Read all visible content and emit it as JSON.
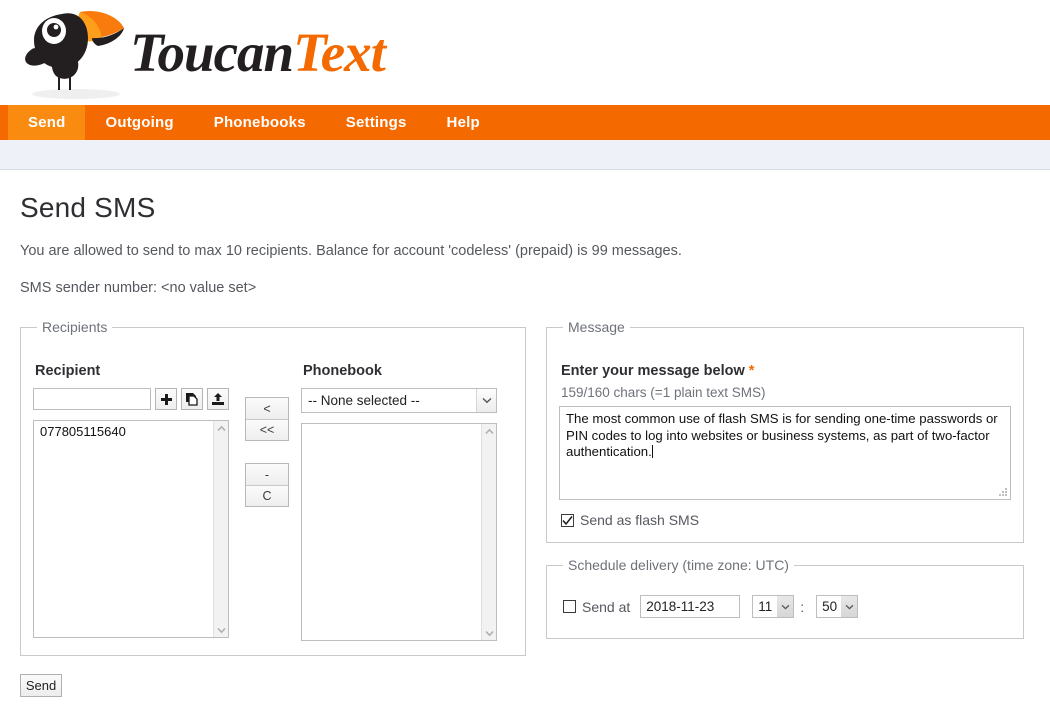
{
  "brand": {
    "name_dark": "Toucan",
    "name_orange": "Text",
    "logo_icon": "toucan-bird-icon",
    "accent_color": "#f56a00",
    "accent_active_color": "#f98b10"
  },
  "nav": {
    "items": [
      {
        "label": "Send",
        "active": true
      },
      {
        "label": "Outgoing",
        "active": false
      },
      {
        "label": "Phonebooks",
        "active": false
      },
      {
        "label": "Settings",
        "active": false
      },
      {
        "label": "Help",
        "active": false
      }
    ]
  },
  "page": {
    "title": "Send SMS",
    "intro": "You are allowed to send to max 10 recipients. Balance for account 'codeless' (prepaid) is 99 messages.",
    "sender_line": "SMS sender number: <no value set>"
  },
  "recipients": {
    "legend": "Recipients",
    "recipient_label": "Recipient",
    "recipient_input_value": "",
    "recipient_input_placeholder": "",
    "buttons": {
      "add": "add-icon",
      "paste": "paste-icon",
      "upload": "upload-icon"
    },
    "list_items": [
      "077805115640"
    ],
    "transfer_buttons": [
      {
        "label": "<",
        "name": "move-one-left-button"
      },
      {
        "label": "<<",
        "name": "move-all-left-button"
      },
      {
        "label": "-",
        "name": "remove-selected-button"
      },
      {
        "label": "C",
        "name": "clear-all-button"
      }
    ],
    "phonebook_label": "Phonebook",
    "phonebook_selected": "-- None selected --",
    "phonebook_list_items": []
  },
  "message": {
    "legend": "Message",
    "label": "Enter your message below",
    "required_marker": "*",
    "char_count": "159/160 chars (=1 plain text SMS)",
    "body": "The most common use of flash SMS is for sending one-time passwords or PIN codes to log into websites or business systems, as part of two-factor authentication.",
    "flash_label": "Send as flash SMS",
    "flash_checked": true
  },
  "schedule": {
    "legend": "Schedule delivery (time zone: UTC)",
    "send_at_label": "Send at",
    "send_at_checked": false,
    "date_value": "2018-11-23",
    "hour_value": "11",
    "separator": ":",
    "minute_value": "50"
  },
  "actions": {
    "send_label": "Send"
  }
}
